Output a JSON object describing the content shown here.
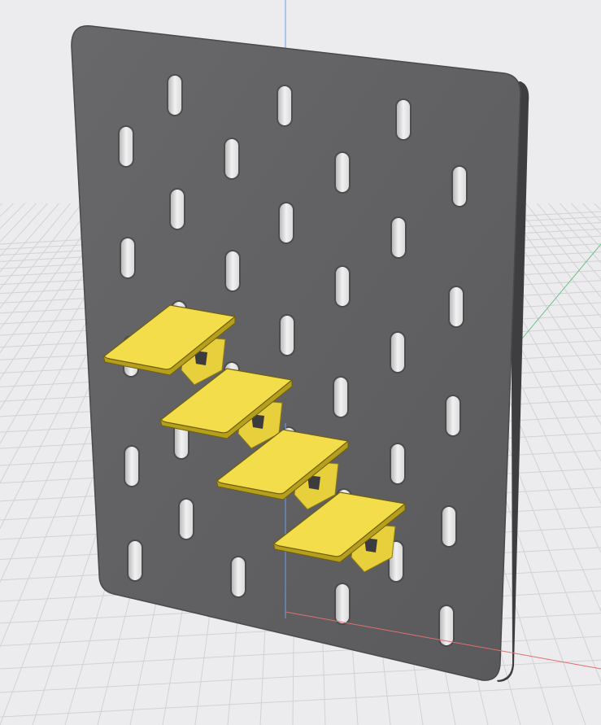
{
  "scene": {
    "kind": "3d-model-viewport",
    "model": {
      "pegboard": {
        "color": "#626264",
        "slot_rows": 11,
        "slots_in_row_pattern": [
          4,
          4
        ]
      },
      "shelves": {
        "count": 4,
        "color": "#f4dd4b",
        "edge_color": "#b69f1c"
      }
    },
    "colors": {
      "background": "#ececee",
      "grid_line": "#d2d2d6",
      "axis_x": "#e07070",
      "axis_y": "#6fc08a",
      "axis_z": "#6f9ee8"
    }
  }
}
